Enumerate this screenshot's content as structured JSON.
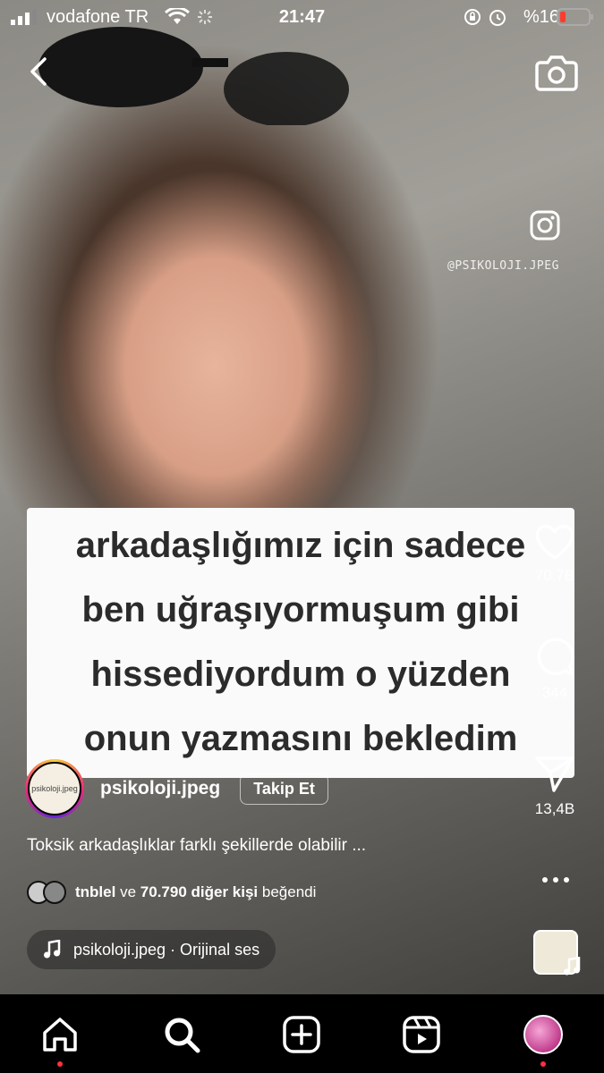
{
  "status_bar": {
    "carrier": "vodafone TR",
    "time": "21:47",
    "battery": "%16",
    "colors": {
      "battery_low": "#ff3b30"
    }
  },
  "header": {
    "back_icon": "chevron-left-icon",
    "camera_icon": "camera-icon"
  },
  "watermark": {
    "icon": "instagram-icon",
    "handle": "@PSIKOLOJI.JPEG"
  },
  "video_caption": {
    "lines": [
      "arkadaşlığımız için sadece",
      "ben uğraşıyormuşum gibi",
      "hissediyordum o yüzden",
      "onun yazmasını bekledim"
    ]
  },
  "actions": {
    "like_count": "70,7B",
    "comment_count": "344",
    "share_count": "13,4B",
    "more_icon": "more-horizontal-icon"
  },
  "author": {
    "username": "psikoloji.jpeg",
    "avatar_text": "psikoloji.jpeg",
    "follow_label": "Takip Et"
  },
  "description": "Toksik arkadaşlıklar farklı şekillerde olabilir ...",
  "liked_by": {
    "user": "tnblel",
    "connector": "ve",
    "others": "70.790 diğer kişi",
    "suffix": "beğendi"
  },
  "audio": {
    "label": "psikoloji.jpeg · Orijinal ses",
    "icon": "music-note-icon"
  },
  "tab_bar": {
    "items": [
      "home-icon",
      "search-icon",
      "create-icon",
      "reels-icon",
      "profile-avatar"
    ],
    "notification_color": "#ff3040"
  }
}
